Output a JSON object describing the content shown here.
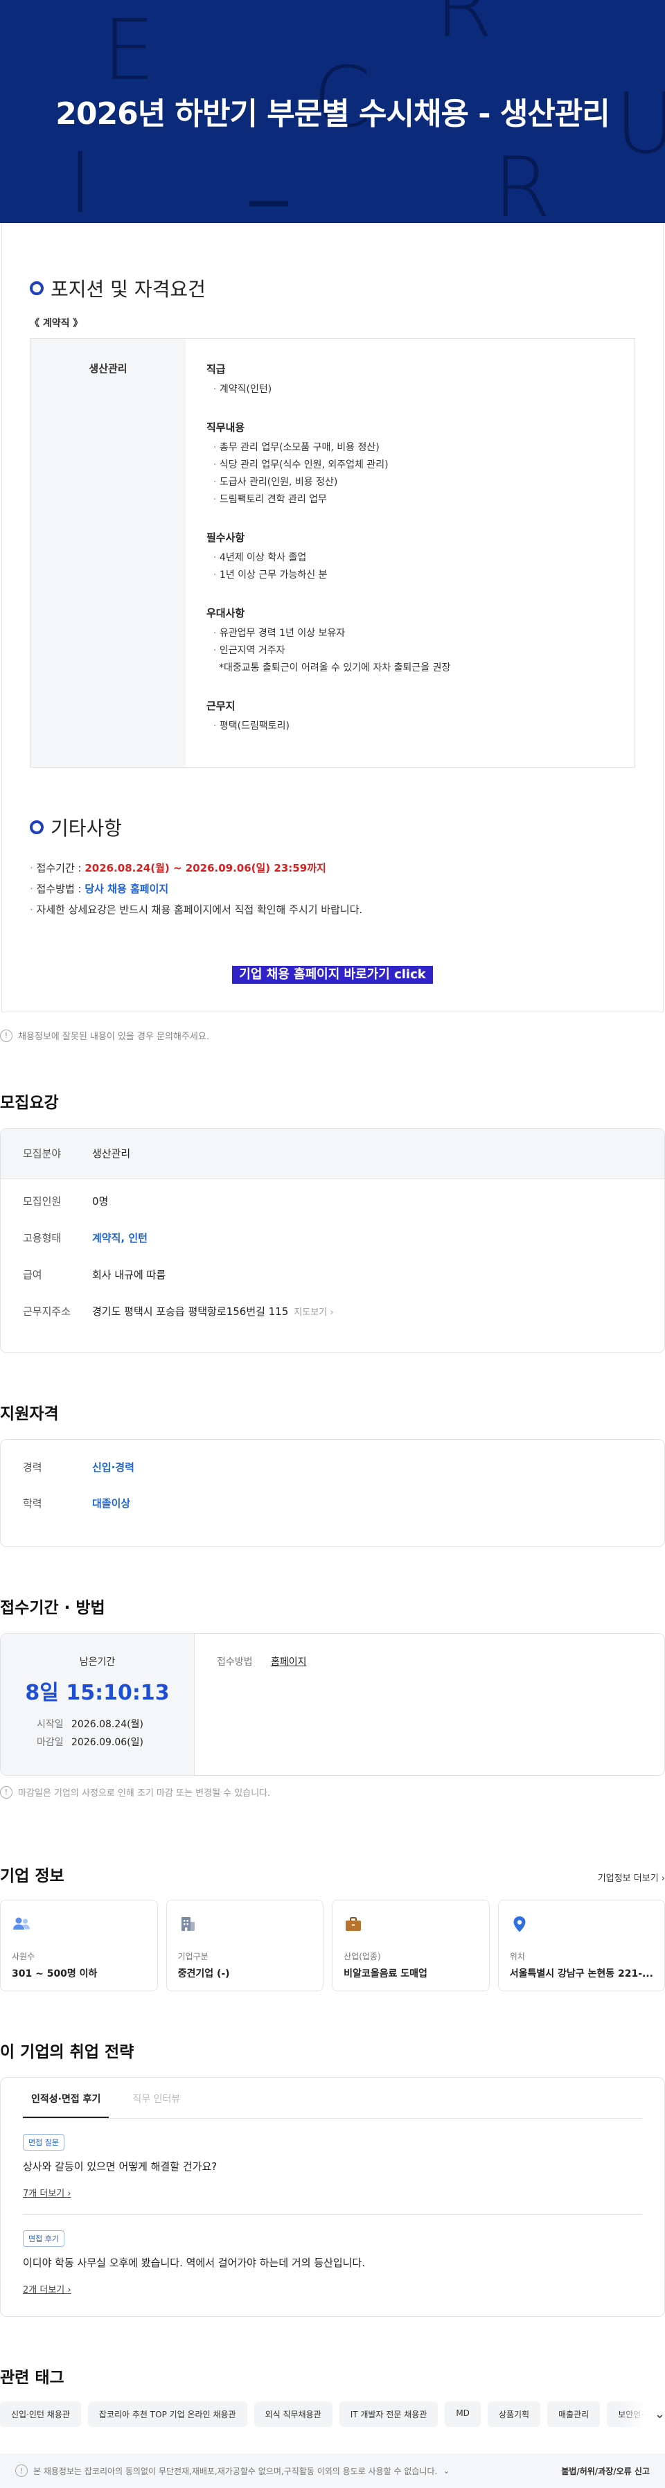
{
  "banner": {
    "title": "2026년 하반기 부문별 수시채용 - 생산관리",
    "bg_letters": [
      "E",
      "R",
      "C",
      "U",
      "R",
      "I"
    ]
  },
  "position": {
    "section_title": "포지션 및 자격요건",
    "contract_label": "《 계약직 》",
    "field": "생산관리",
    "groups": [
      {
        "title": "직급",
        "items": [
          "계약직(인턴)"
        ]
      },
      {
        "title": "직무내용",
        "items": [
          "총무 관리 업무(소모품 구매, 비용 정산)",
          "식당 관리 업무(식수 인원, 외주업체 관리)",
          "도급사 관리(인원, 비용 정산)",
          "드림팩토리 견학 관리 업무"
        ]
      },
      {
        "title": "필수사항",
        "items": [
          "4년제 이상 학사 졸업",
          "1년 이상 근무 가능하신 분"
        ]
      },
      {
        "title": "우대사항",
        "items": [
          "유관업무 경력 1년 이상 보유자",
          "인근지역 거주자"
        ],
        "note": "*대중교통 출퇴근이 어려울 수 있기에 자차 출퇴근을 권장"
      },
      {
        "title": "근무지",
        "items": [
          "평택(드림팩토리)"
        ]
      }
    ]
  },
  "etc": {
    "section_title": "기타사항",
    "period_label": "접수기간 : ",
    "period_value": "2026.08.24(월) ~ 2026.09.06(일) 23:59까지",
    "method_label": "접수방법 : ",
    "method_value": "당사 채용 홈페이지",
    "detail_text": "자세한 상세요강은 반드시 채용 홈페이지에서 직접 확인해 주시기 바랍니다.",
    "home_button": "기업 채용 홈페이지 바로가기 click"
  },
  "report": {
    "text": "채용정보에 잘못된 내용이 있을 경우 문의해주세요."
  },
  "recruit": {
    "title": "모집요강",
    "head": {
      "label": "모집분야",
      "value": "생산관리"
    },
    "rows": [
      {
        "label": "모집인원",
        "value": "0명",
        "blue": false
      },
      {
        "label": "고용형태",
        "value": "계약직, 인턴",
        "blue": true
      },
      {
        "label": "급여",
        "value": "회사 내규에 따름",
        "blue": false
      },
      {
        "label": "근무지주소",
        "value": "경기도 평택시 포승읍 평택항로156번길 115",
        "blue": false
      }
    ],
    "map_link": "지도보기"
  },
  "qualification": {
    "title": "지원자격",
    "rows": [
      {
        "label": "경력",
        "value": "신입·경력"
      },
      {
        "label": "학력",
        "value": "대졸이상"
      }
    ]
  },
  "period": {
    "title": "접수기간 · 방법",
    "remain_label": "남은기간",
    "remain_value": "8일 15:10:13",
    "start_label": "시작일",
    "start_value": "2026.08.24(월)",
    "end_label": "마감일",
    "end_value": "2026.09.06(일)",
    "method_label": "접수방법",
    "method_value": "홈페이지",
    "note": "마감일은 기업의 사정으로 인해 조기 마감 또는 변경될 수 있습니다."
  },
  "company": {
    "title": "기업 정보",
    "more": "기업정보 더보기",
    "cards": [
      {
        "icon": "people-icon",
        "label": "사원수",
        "value": "301 ~ 500명 이하"
      },
      {
        "icon": "building-icon",
        "label": "기업구분",
        "value": "중견기업 (-)"
      },
      {
        "icon": "briefcase-icon",
        "label": "산업(업종)",
        "value": "비알코올음료 도매업"
      },
      {
        "icon": "location-pin-icon",
        "label": "위치",
        "value": "서울특별시 강남구 논현동 221-..."
      }
    ],
    "colors": {
      "people": "#5b8def",
      "building": "#7d8aa3",
      "briefcase": "#b8742f",
      "pin": "#2f6fe0"
    }
  },
  "strategy": {
    "title": "이 기업의 취업 전략",
    "tabs": [
      "인적성·면접 후기",
      "직무 인터뷰"
    ],
    "items": [
      {
        "badge": "면접 질문",
        "text": "상사와 갈등이 있으면 어떻게 해결할 건가요?",
        "more": "7개 더보기"
      },
      {
        "badge": "면접 후기",
        "text": "이디야 학동 사무실 오후에 봤습니다. 역에서 걸어가야 하는데 거의 등산입니다.",
        "more": "2개 더보기"
      }
    ]
  },
  "tags": {
    "title": "관련 태그",
    "items": [
      "신입·인턴 채용관",
      "잡코리아 추천 TOP 기업 온라인 채용관",
      "외식 직무채용관",
      "IT 개발자 전문 채용관",
      "MD",
      "상품기획",
      "매출관리",
      "보안연구"
    ]
  },
  "footer": {
    "notice": "본 채용정보는 잡코리아의 동의없이 무단전재,재배포,재가공할수 없으며,구직활동 이외의 용도로 사용할 수 없습니다.",
    "report": "불법/허위/과장/오류 신고"
  }
}
